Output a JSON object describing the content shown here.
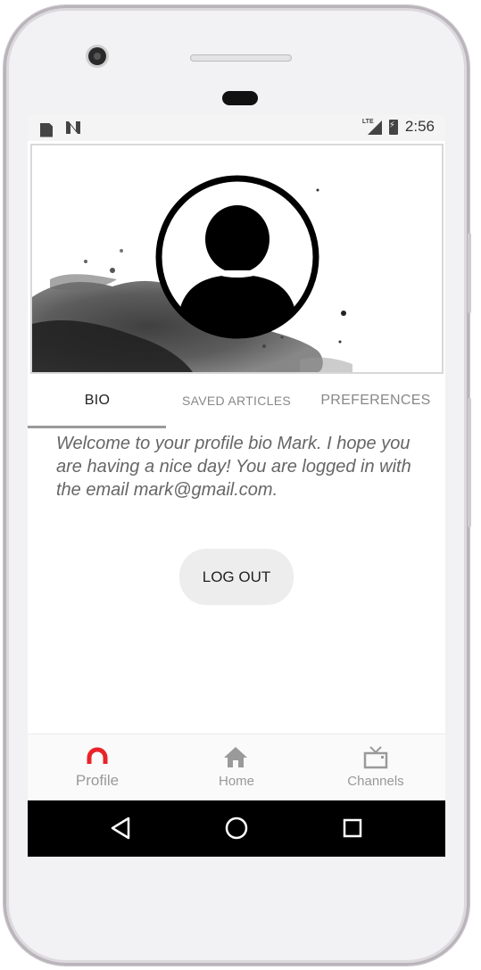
{
  "status_bar": {
    "network_label": "LTE",
    "time": "2:56"
  },
  "tabs": [
    {
      "label": "BIO",
      "active": true
    },
    {
      "label": "SAVED ARTICLES",
      "active": false
    },
    {
      "label": "PREFERENCES",
      "active": false
    }
  ],
  "bio": {
    "text": "Welcome to your profile bio Mark. I hope you are having a nice day! You are logged in with the email mark@gmail.com."
  },
  "actions": {
    "logout_label": "LOG OUT"
  },
  "bottom_nav": [
    {
      "label": "Profile",
      "icon": "profile-arc-icon",
      "active": true
    },
    {
      "label": "Home",
      "icon": "home-icon",
      "active": false
    },
    {
      "label": "Channels",
      "icon": "tv-icon",
      "active": false
    }
  ],
  "android_nav": {
    "buttons": [
      "back-icon",
      "home-circle-icon",
      "recents-icon"
    ]
  },
  "colors": {
    "accent": "#e8232a",
    "nav_inactive": "#999999",
    "system_bar": "#000000"
  }
}
